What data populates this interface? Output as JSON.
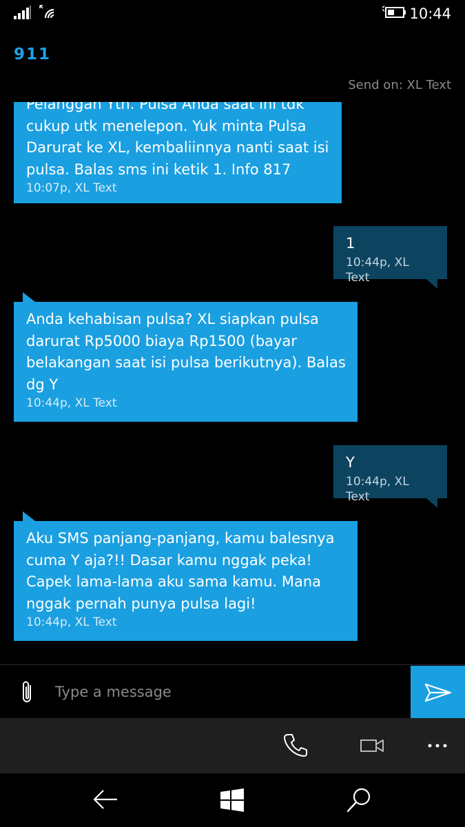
{
  "status": {
    "time": "10:44"
  },
  "header": {
    "contact": "911",
    "send_on": "Send on: XL Text"
  },
  "messages": [
    {
      "direction": "in",
      "text": "Pelanggan Yth. Pulsa Anda saat ini tdk cukup utk menelepon. Yuk minta Pulsa Darurat ke XL, kembaliinnya nanti saat isi pulsa. Balas sms ini ketik 1. Info 817",
      "meta": "10:07p, XL Text"
    },
    {
      "direction": "out",
      "text": "1",
      "meta": "10:44p, XL Text"
    },
    {
      "direction": "in",
      "text": "Anda kehabisan pulsa? XL siapkan pulsa darurat Rp5000 biaya Rp1500 (bayar belakangan saat isi pulsa berikutnya). Balas dg Y",
      "meta": "10:44p, XL Text"
    },
    {
      "direction": "out",
      "text": "Y",
      "meta": "10:44p, XL Text"
    },
    {
      "direction": "in",
      "text": "Aku SMS panjang-panjang, kamu balesnya cuma Y aja?!! Dasar kamu nggak peka! Capek lama-lama aku sama kamu. Mana nggak pernah punya pulsa lagi!",
      "meta": "10:44p, XL Text"
    }
  ],
  "compose": {
    "placeholder": "Type a message"
  },
  "icons": {
    "attach": "paperclip-icon",
    "send": "send-arrow-icon",
    "call": "phone-icon",
    "video": "video-camera-icon",
    "more": "more-dots-icon",
    "back": "back-arrow-icon",
    "start": "windows-logo-icon",
    "search": "search-icon"
  },
  "colors": {
    "accent": "#1a9fe0",
    "incoming_bubble": "#1a9fe0",
    "outgoing_bubble": "#0c4460",
    "background": "#000000"
  }
}
